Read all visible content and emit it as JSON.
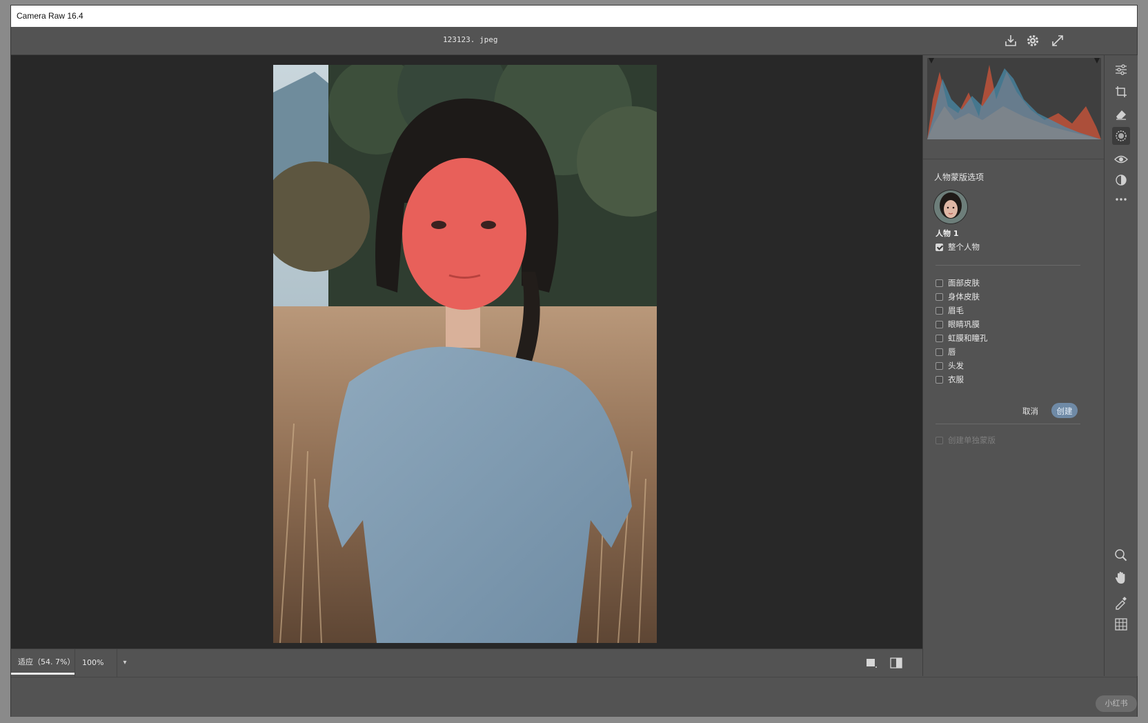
{
  "window": {
    "title": "Camera Raw 16.4"
  },
  "topbar": {
    "filename": "123123. jpeg",
    "icons": [
      "download-icon",
      "gear-icon",
      "expand-icon"
    ]
  },
  "bottombar": {
    "zoom_fit_label": "适应（54. 7%）",
    "zoom_100_label": "100%",
    "icons": [
      "single-view-icon",
      "before-after-icon"
    ]
  },
  "panel": {
    "section_title": "人物蒙版选项",
    "person_label": "人物 1",
    "whole_person": {
      "label": "整个人物",
      "checked": true
    },
    "parts": [
      {
        "label": "面部皮肤",
        "checked": false
      },
      {
        "label": "身体皮肤",
        "checked": false
      },
      {
        "label": "眉毛",
        "checked": false
      },
      {
        "label": "眼睛巩膜",
        "checked": false
      },
      {
        "label": "虹膜和瞳孔",
        "checked": false
      },
      {
        "label": "唇",
        "checked": false
      },
      {
        "label": "头发",
        "checked": false
      },
      {
        "label": "衣服",
        "checked": false
      }
    ],
    "cancel_label": "取消",
    "create_label": "创建",
    "separate_masks": {
      "label": "创建单独蒙版",
      "checked": false,
      "disabled": true
    }
  },
  "toolstrip": {
    "icons": [
      "sliders-icon",
      "crop-icon",
      "eraser-icon",
      "mask-icon",
      "redeye-icon",
      "presets-icon",
      "more-icon",
      "zoom-icon",
      "hand-icon",
      "color-sampler-icon",
      "grid-icon"
    ],
    "active": "mask-icon"
  },
  "colors": {
    "mask_overlay": "#e8605a",
    "accent_button": "#6f8aa6",
    "histogram_red": "#d2553a",
    "histogram_blue": "#4a90b0"
  },
  "watermark": "小红书"
}
